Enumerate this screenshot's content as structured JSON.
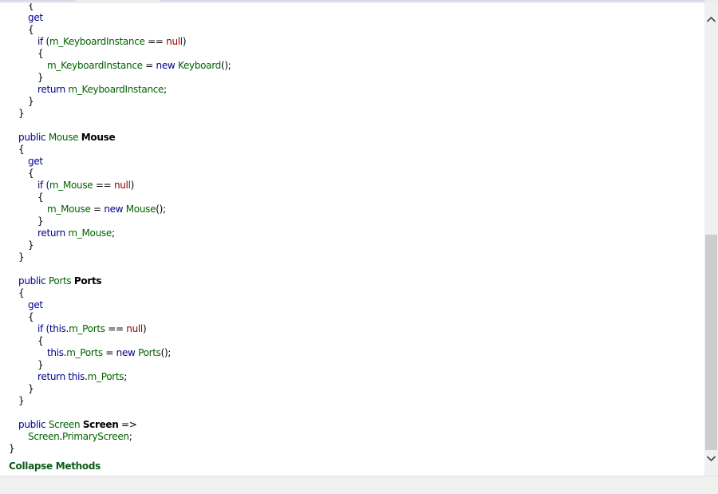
{
  "collapse_label": "Collapse Methods",
  "code_lines": [
    [
      {
        "t": "{",
        "c": "pl"
      }
    ],
    [
      {
        "t": "get",
        "c": "kw"
      }
    ],
    [
      {
        "t": "{",
        "c": "pl"
      }
    ],
    [
      {
        "t": "if (",
        "c": "kw"
      },
      {
        "t": "m_KeyboardInstance",
        "c": "id"
      },
      {
        "t": " == ",
        "c": "pl"
      },
      {
        "t": "null",
        "c": "nl"
      },
      {
        "t": ")",
        "c": "pl"
      }
    ],
    [
      {
        "t": "{",
        "c": "pl"
      }
    ],
    [
      {
        "t": "m_KeyboardInstance",
        "c": "id"
      },
      {
        "t": " = ",
        "c": "pl"
      },
      {
        "t": "new ",
        "c": "kw"
      },
      {
        "t": "Keyboard",
        "c": "id"
      },
      {
        "t": "();",
        "c": "pl"
      }
    ],
    [
      {
        "t": "}",
        "c": "pl"
      }
    ],
    [
      {
        "t": "return ",
        "c": "kw"
      },
      {
        "t": "m_KeyboardInstance",
        "c": "id"
      },
      {
        "t": ";",
        "c": "pl"
      }
    ],
    [
      {
        "t": "}",
        "c": "pl"
      }
    ],
    [
      {
        "t": "}",
        "c": "pl"
      }
    ],
    [],
    [
      {
        "t": "public ",
        "c": "kw"
      },
      {
        "t": "Mouse ",
        "c": "id"
      },
      {
        "t": "Mouse",
        "c": "bold"
      }
    ],
    [
      {
        "t": "{",
        "c": "pl"
      }
    ],
    [
      {
        "t": "get",
        "c": "kw"
      }
    ],
    [
      {
        "t": "{",
        "c": "pl"
      }
    ],
    [
      {
        "t": "if (",
        "c": "kw"
      },
      {
        "t": "m_Mouse",
        "c": "id"
      },
      {
        "t": " == ",
        "c": "pl"
      },
      {
        "t": "null",
        "c": "nl"
      },
      {
        "t": ")",
        "c": "pl"
      }
    ],
    [
      {
        "t": "{",
        "c": "pl"
      }
    ],
    [
      {
        "t": "m_Mouse",
        "c": "id"
      },
      {
        "t": " = ",
        "c": "pl"
      },
      {
        "t": "new ",
        "c": "kw"
      },
      {
        "t": "Mouse",
        "c": "id"
      },
      {
        "t": "();",
        "c": "pl"
      }
    ],
    [
      {
        "t": "}",
        "c": "pl"
      }
    ],
    [
      {
        "t": "return ",
        "c": "kw"
      },
      {
        "t": "m_Mouse",
        "c": "id"
      },
      {
        "t": ";",
        "c": "pl"
      }
    ],
    [
      {
        "t": "}",
        "c": "pl"
      }
    ],
    [
      {
        "t": "}",
        "c": "pl"
      }
    ],
    [],
    [
      {
        "t": "public ",
        "c": "kw"
      },
      {
        "t": "Ports ",
        "c": "id"
      },
      {
        "t": "Ports",
        "c": "bold"
      }
    ],
    [
      {
        "t": "{",
        "c": "pl"
      }
    ],
    [
      {
        "t": "get",
        "c": "kw"
      }
    ],
    [
      {
        "t": "{",
        "c": "pl"
      }
    ],
    [
      {
        "t": "if (",
        "c": "kw"
      },
      {
        "t": "this",
        "c": "kw"
      },
      {
        "t": ".",
        "c": "pl"
      },
      {
        "t": "m_Ports",
        "c": "id"
      },
      {
        "t": " == ",
        "c": "pl"
      },
      {
        "t": "null",
        "c": "nl"
      },
      {
        "t": ")",
        "c": "pl"
      }
    ],
    [
      {
        "t": "{",
        "c": "pl"
      }
    ],
    [
      {
        "t": "this",
        "c": "kw"
      },
      {
        "t": ".",
        "c": "pl"
      },
      {
        "t": "m_Ports",
        "c": "id"
      },
      {
        "t": " = ",
        "c": "pl"
      },
      {
        "t": "new ",
        "c": "kw"
      },
      {
        "t": "Ports",
        "c": "id"
      },
      {
        "t": "();",
        "c": "pl"
      }
    ],
    [
      {
        "t": "}",
        "c": "pl"
      }
    ],
    [
      {
        "t": "return ",
        "c": "kw"
      },
      {
        "t": "this",
        "c": "kw"
      },
      {
        "t": ".",
        "c": "pl"
      },
      {
        "t": "m_Ports",
        "c": "id"
      },
      {
        "t": ";",
        "c": "pl"
      }
    ],
    [
      {
        "t": "}",
        "c": "pl"
      }
    ],
    [
      {
        "t": "}",
        "c": "pl"
      }
    ],
    [],
    [
      {
        "t": "public ",
        "c": "kw"
      },
      {
        "t": "Screen ",
        "c": "id"
      },
      {
        "t": "Screen",
        "c": "bold"
      },
      {
        "t": " =>",
        "c": "pl"
      }
    ],
    [
      {
        "t": "Screen",
        "c": "id"
      },
      {
        "t": ".",
        "c": "pl"
      },
      {
        "t": "PrimaryScreen",
        "c": "id"
      },
      {
        "t": ";",
        "c": "pl"
      }
    ],
    [
      {
        "t": "}",
        "c": "pl"
      }
    ]
  ],
  "icons": {
    "scroll_up": "chevron-up-icon",
    "scroll_down": "chevron-down-icon"
  }
}
